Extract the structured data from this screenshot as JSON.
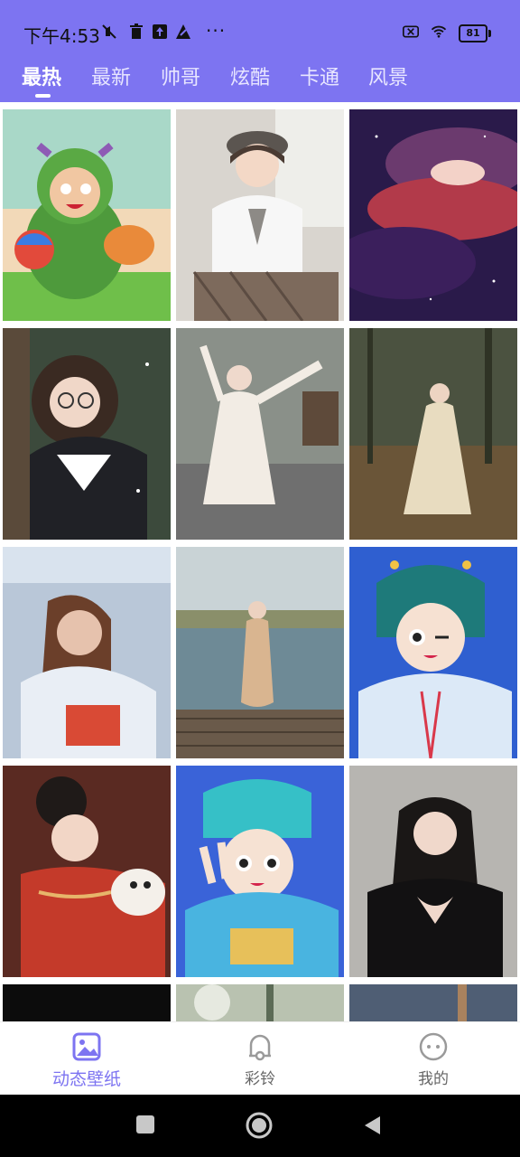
{
  "status_bar": {
    "time": "下午4:53",
    "more": "···",
    "battery": "81"
  },
  "tabs": [
    {
      "label": "最热",
      "active": true
    },
    {
      "label": "最新",
      "active": false
    },
    {
      "label": "帅哥",
      "active": false
    },
    {
      "label": "炫酷",
      "active": false
    },
    {
      "label": "卡通",
      "active": false
    },
    {
      "label": "风景",
      "active": false
    }
  ],
  "colors": {
    "accent": "#7d74f1"
  },
  "wallpapers": [
    {
      "subject": "cartoon-monster-kid",
      "icon": "wallpaper-thumb"
    },
    {
      "subject": "girl-with-beret-glasses",
      "icon": "wallpaper-thumb"
    },
    {
      "subject": "purple-red-nebula",
      "icon": "wallpaper-thumb"
    },
    {
      "subject": "girl-sailor-uniform",
      "icon": "wallpaper-thumb"
    },
    {
      "subject": "dancer-white-dress",
      "icon": "wallpaper-thumb"
    },
    {
      "subject": "woman-hanfu-forest",
      "icon": "wallpaper-thumb"
    },
    {
      "subject": "woman-long-hair-jacket",
      "icon": "wallpaper-thumb"
    },
    {
      "subject": "woman-qipao-lake",
      "icon": "wallpaper-thumb"
    },
    {
      "subject": "cartoon-opera-girl",
      "icon": "wallpaper-thumb"
    },
    {
      "subject": "woman-red-hanfu",
      "icon": "wallpaper-thumb"
    },
    {
      "subject": "cartoon-opera-boy",
      "icon": "wallpaper-thumb"
    },
    {
      "subject": "woman-black-dress-heart",
      "icon": "wallpaper-thumb"
    }
  ],
  "bottom_nav": [
    {
      "label": "动态壁纸",
      "icon": "wallpaper-icon",
      "active": true
    },
    {
      "label": "彩铃",
      "icon": "ringtone-icon",
      "active": false
    },
    {
      "label": "我的",
      "icon": "profile-icon",
      "active": false
    }
  ]
}
